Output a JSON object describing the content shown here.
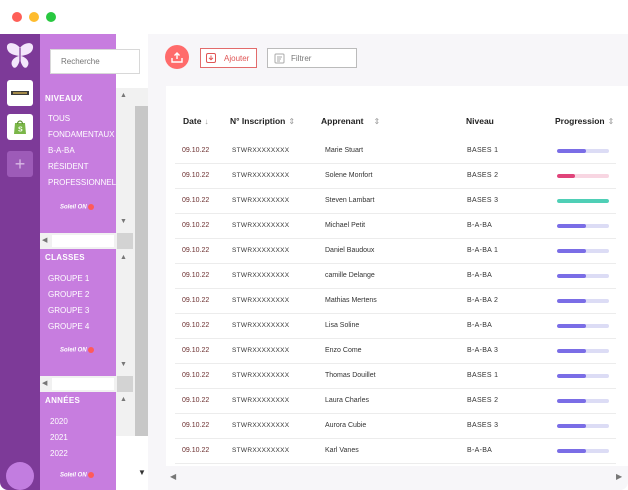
{
  "sidebar": {
    "search_placeholder": "Recherche",
    "sections": {
      "niveaux": {
        "title": "NIVEAUX",
        "items": [
          "TOUS",
          "FONDAMENTAUX",
          "B-A-BA",
          "RÉSIDENT",
          "PROFESSIONNEL"
        ],
        "brand": "Soleil ON"
      },
      "classes": {
        "title": "CLASSES",
        "items": [
          "GROUPE 1",
          "GROUPE 2",
          "GROUPE 3",
          "GROUPE 4"
        ],
        "brand": "Soleil ON"
      },
      "annees": {
        "title": "ANNÉES",
        "items": [
          "2020",
          "2021",
          "2022"
        ],
        "brand": "Soleil ON"
      }
    }
  },
  "toolbar": {
    "add_label": "Ajouter",
    "filter_placeholder": "Filtrer"
  },
  "table": {
    "columns": {
      "date": "Date",
      "inscription": "N° Inscription",
      "apprenant": "Apprenant",
      "niveau": "Niveau",
      "progression": "Progression"
    },
    "rows": [
      {
        "date": "09.10.22",
        "inscription": "STWRXXXXXXXX",
        "apprenant": "Marie Stuart",
        "niveau": "BASES 1",
        "progress": 0.55,
        "color": "#7a6de6"
      },
      {
        "date": "09.10.22",
        "inscription": "STWRXXXXXXXX",
        "apprenant": "Solene Monfort",
        "niveau": "BASES 2",
        "progress": 0.35,
        "color": "#e0447a"
      },
      {
        "date": "09.10.22",
        "inscription": "STWRXXXXXXXX",
        "apprenant": "Steven Lambart",
        "niveau": "BASES 3",
        "progress": 1.0,
        "color": "#4fcfb6"
      },
      {
        "date": "09.10.22",
        "inscription": "STWRXXXXXXXX",
        "apprenant": "Michael Petit",
        "niveau": "B-A-BA",
        "progress": 0.55,
        "color": "#7a6de6"
      },
      {
        "date": "09.10.22",
        "inscription": "STWRXXXXXXXX",
        "apprenant": "Daniel Baudoux",
        "niveau": "B-A-BA 1",
        "progress": 0.55,
        "color": "#7a6de6"
      },
      {
        "date": "09.10.22",
        "inscription": "STWRXXXXXXXX",
        "apprenant": "camille Delange",
        "niveau": "B-A-BA",
        "progress": 0.55,
        "color": "#7a6de6"
      },
      {
        "date": "09.10.22",
        "inscription": "STWRXXXXXXXX",
        "apprenant": "Mathias Mertens",
        "niveau": "B-A-BA 2",
        "progress": 0.55,
        "color": "#7a6de6"
      },
      {
        "date": "09.10.22",
        "inscription": "STWRXXXXXXXX",
        "apprenant": "Lisa Soline",
        "niveau": "B-A-BA",
        "progress": 0.55,
        "color": "#7a6de6"
      },
      {
        "date": "09.10.22",
        "inscription": "STWRXXXXXXXX",
        "apprenant": "Enzo Come",
        "niveau": "B-A-BA 3",
        "progress": 0.55,
        "color": "#7a6de6"
      },
      {
        "date": "09.10.22",
        "inscription": "STWRXXXXXXXX",
        "apprenant": "Thomas Douillet",
        "niveau": "BASES 1",
        "progress": 0.55,
        "color": "#7a6de6"
      },
      {
        "date": "09.10.22",
        "inscription": "STWRXXXXXXXX",
        "apprenant": "Laura Charles",
        "niveau": "BASES 2",
        "progress": 0.55,
        "color": "#7a6de6"
      },
      {
        "date": "09.10.22",
        "inscription": "STWRXXXXXXXX",
        "apprenant": "Aurora Cubie",
        "niveau": "BASES 3",
        "progress": 0.55,
        "color": "#7a6de6"
      },
      {
        "date": "09.10.22",
        "inscription": "STWRXXXXXXXX",
        "apprenant": "Karl Vanes",
        "niveau": "B-A-BA",
        "progress": 0.55,
        "color": "#7a6de6"
      }
    ]
  },
  "colors": {
    "rail": "#7d3a98",
    "panel": "#c77ddf",
    "accent": "#ff6b6b"
  }
}
